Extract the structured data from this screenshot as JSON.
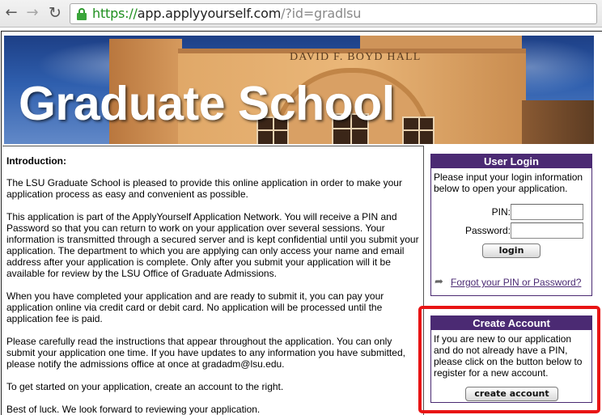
{
  "browser": {
    "url_scheme": "https://",
    "url_host": "app.applyyourself.com",
    "url_path": "/?id=gradlsu",
    "icons": [
      "back-arrow-icon",
      "forward-arrow-icon",
      "reload-icon",
      "lock-icon"
    ]
  },
  "banner": {
    "building_name": "DAVID F. BOYD HALL",
    "title": "Graduate School"
  },
  "intro": {
    "heading": "Introduction:",
    "paragraphs": [
      "The LSU Graduate School is pleased to provide this online application in order to make your application process as easy and convenient as possible.",
      "This application is part of the ApplyYourself Application Network. You will receive a PIN and Password so that you can return to work on your application over several sessions. Your information is transmitted through a secured server and is kept confidential until you submit your application. The department to which you are applying can only access your name and email address after your application is complete. Only after you submit your application will it be available for review by the LSU Office of Graduate Admissions.",
      "When you have completed your application and are ready to submit it, you can pay your application online via credit card or debit card. No application will be processed until the application fee is paid.",
      "Please carefully read the instructions that appear throughout the application. You can only submit your application one time. If you have updates to any information you have submitted, please notify the admissions office at once at gradadm@lsu.edu.",
      "To get started on your application, create an account to the right.",
      "Best of luck. We look forward to reviewing your application."
    ]
  },
  "login": {
    "header": "User Login",
    "instructions": "Please input your login information below to open your application.",
    "pin_label": "PIN:",
    "pin_value": "",
    "password_label": "Password:",
    "password_value": "",
    "button": "login",
    "forgot_link": "Forgot your PIN or Password?"
  },
  "create": {
    "header": "Create Account",
    "instructions": "If you are new to our application and do not already have a PIN, please click on the button below to register for a new account.",
    "button": "create account"
  },
  "colors": {
    "box_header": "#4b2a73",
    "highlight": "#e81414",
    "url_scheme": "#1f8f1f"
  }
}
